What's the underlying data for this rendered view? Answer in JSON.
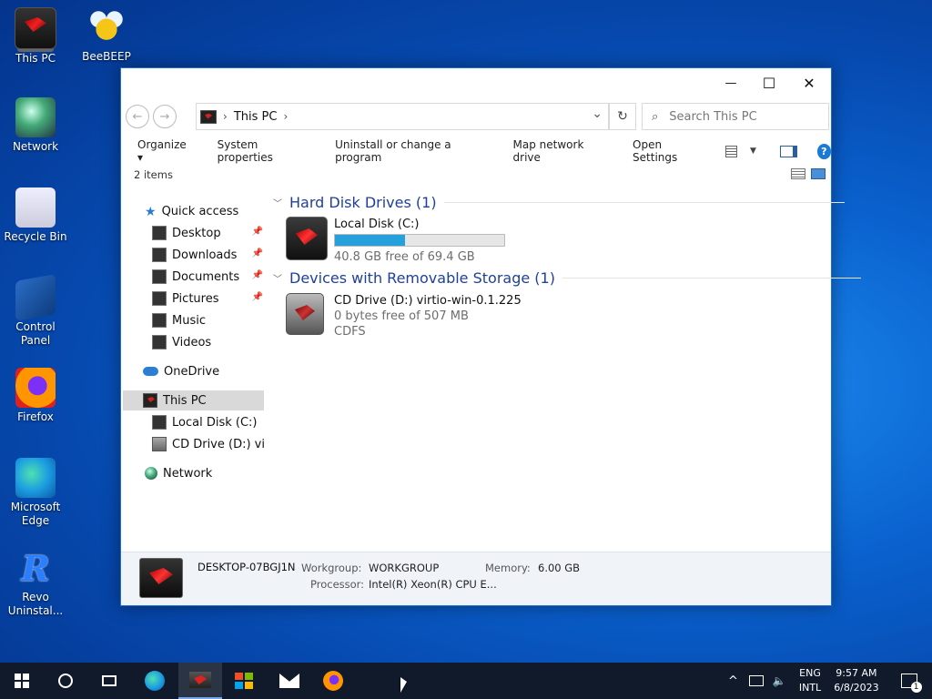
{
  "desktop": {
    "icons": [
      {
        "label": "This PC",
        "icon": "this-pc-icon"
      },
      {
        "label": "BeeBEEP",
        "icon": "beebeep-icon"
      },
      {
        "label": "Network",
        "icon": "network-icon"
      },
      {
        "label": "Recycle Bin",
        "icon": "recycle-bin-icon"
      },
      {
        "label": "Control Panel",
        "icon": "control-panel-icon"
      },
      {
        "label": "Firefox",
        "icon": "firefox-icon"
      },
      {
        "label": "Microsoft Edge",
        "icon": "edge-icon"
      },
      {
        "label": "Revo Uninstal...",
        "icon": "revo-uninstaller-icon"
      }
    ]
  },
  "window": {
    "controls": {
      "minimize": "—",
      "maximize": "☐",
      "close": "✕"
    },
    "nav": {
      "back": "←",
      "forward": "→"
    },
    "address": {
      "segment": "This PC",
      "sep": "›",
      "dropdown": "⌄",
      "refresh": "↻"
    },
    "search": {
      "placeholder": "Search This PC"
    },
    "commands": {
      "organize": "Organize ▾",
      "system_properties": "System properties",
      "uninstall": "Uninstall or change a program",
      "map_drive": "Map network drive",
      "open_settings": "Open Settings"
    },
    "item_count": "2 items",
    "navpane": {
      "quick_access": "Quick access",
      "quick_items": [
        "Desktop",
        "Downloads",
        "Documents",
        "Pictures",
        "Music",
        "Videos"
      ],
      "onedrive": "OneDrive",
      "this_pc": "This PC",
      "local_disk": "Local Disk (C:)",
      "cd_drive": "CD Drive (D:) virtio",
      "network": "Network"
    },
    "groups": {
      "hdd": "Hard Disk Drives (1)",
      "removable": "Devices with Removable Storage (1)"
    },
    "drives": {
      "c": {
        "name": "Local Disk (C:)",
        "free_text": "40.8 GB free of 69.4 GB",
        "used_fraction": 0.412
      },
      "d": {
        "name": "CD Drive (D:) virtio-win-0.1.225",
        "free_text": "0 bytes free of 507 MB",
        "fs": "CDFS"
      }
    },
    "details": {
      "computer_name": "DESKTOP-07BGJ1N",
      "workgroup_label": "Workgroup:",
      "workgroup": "WORKGROUP",
      "memory_label": "Memory:",
      "memory": "6.00 GB",
      "processor_label": "Processor:",
      "processor": "Intel(R) Xeon(R) CPU E..."
    }
  },
  "taskbar": {
    "tray": {
      "lang_top": "ENG",
      "lang_bottom": "INTL",
      "time": "9:57 AM",
      "date": "6/8/2023",
      "notif_count": "1",
      "chevron": "^"
    }
  },
  "colors": {
    "accent": "#0078d7",
    "group_header": "#1f3f9c",
    "bar_fill": "#26a0da"
  }
}
